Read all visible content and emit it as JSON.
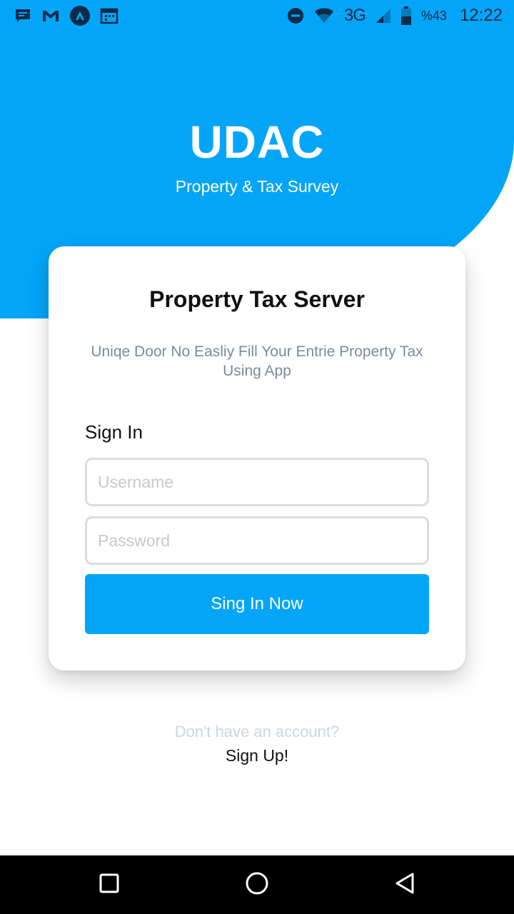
{
  "status_bar": {
    "left_icons": [
      "chat-icon",
      "gmail-icon",
      "app-a-icon",
      "calendar-icon"
    ],
    "network": "3G",
    "battery": "%43",
    "time": "12:22"
  },
  "header": {
    "title": "UDAC",
    "subtitle": "Property & Tax Survey"
  },
  "card": {
    "title": "Property Tax Server",
    "description": "Uniqe Door No Easliy Fill Your Entrie Property Tax Using App",
    "signin_label": "Sign In",
    "username_placeholder": "Username",
    "password_placeholder": "Password",
    "submit_label": "Sing In Now"
  },
  "footer": {
    "no_account_text": "Don't have an account?",
    "signup_label": "Sign Up!"
  },
  "colors": {
    "accent": "#03a5f8",
    "card_bg": "#ffffff",
    "nav_bg": "#000000"
  }
}
